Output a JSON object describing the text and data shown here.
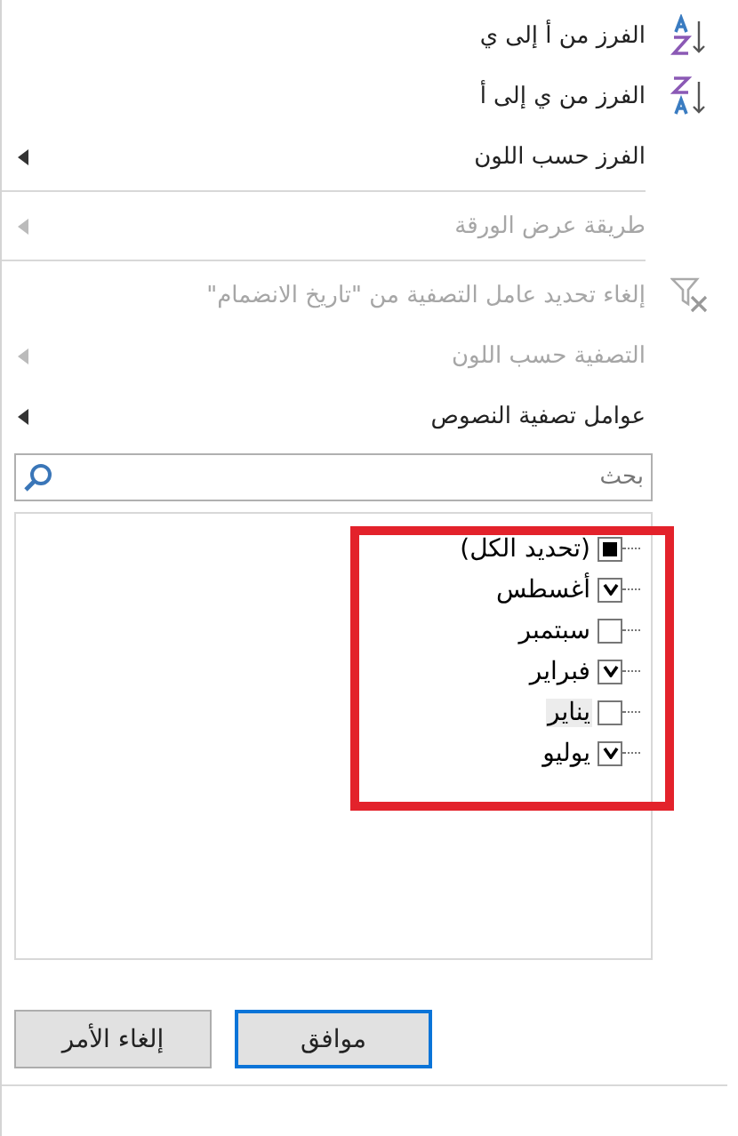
{
  "menu": [
    {
      "label": "الفرز من أ إلى ي",
      "kind": "sort_asc",
      "disabled": false,
      "submenu": false
    },
    {
      "label": "الفرز من ي إلى أ",
      "kind": "sort_desc",
      "disabled": false,
      "submenu": false
    },
    {
      "label": "الفرز حسب اللون",
      "kind": "plain",
      "disabled": false,
      "submenu": true
    },
    {
      "kind": "separator"
    },
    {
      "label": "طريقة عرض الورقة",
      "kind": "plain",
      "disabled": true,
      "submenu": true
    },
    {
      "kind": "separator"
    },
    {
      "label": "إلغاء تحديد عامل التصفية من \"تاريخ الانضمام\"",
      "kind": "clear_filter",
      "disabled": true,
      "submenu": false
    },
    {
      "label": "التصفية حسب اللون",
      "kind": "plain",
      "disabled": true,
      "submenu": true
    },
    {
      "label": "عوامل تصفية النصوص",
      "kind": "plain",
      "disabled": false,
      "submenu": true
    }
  ],
  "search": {
    "placeholder": "بحث"
  },
  "values": [
    {
      "label": "(تحديد الكل)",
      "checked": true,
      "indeterminate": true,
      "selected": false
    },
    {
      "label": "أغسطس",
      "checked": true,
      "indeterminate": false,
      "selected": false
    },
    {
      "label": "سبتمبر",
      "checked": false,
      "indeterminate": false,
      "selected": false
    },
    {
      "label": "فبراير",
      "checked": true,
      "indeterminate": false,
      "selected": false
    },
    {
      "label": "يناير",
      "checked": false,
      "indeterminate": false,
      "selected": true
    },
    {
      "label": "يوليو",
      "checked": true,
      "indeterminate": false,
      "selected": false
    }
  ],
  "highlight_frame": true,
  "buttons": [
    {
      "label": "موافق",
      "default": true
    },
    {
      "label": "إلغاء الأمر",
      "default": false
    }
  ]
}
